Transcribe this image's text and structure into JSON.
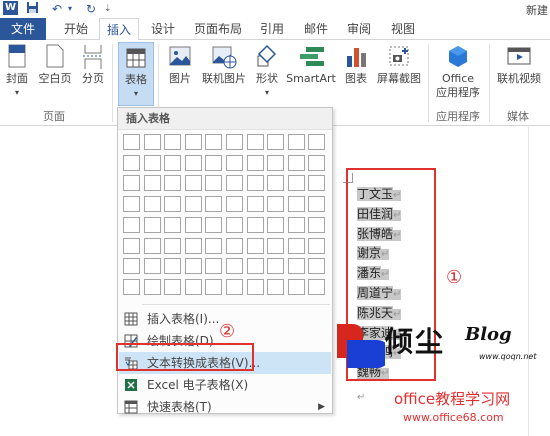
{
  "titlebar": {
    "doc_title": "新建"
  },
  "tabs": [
    {
      "label": "文件"
    },
    {
      "label": "开始"
    },
    {
      "label": "插入"
    },
    {
      "label": "设计"
    },
    {
      "label": "页面布局"
    },
    {
      "label": "引用"
    },
    {
      "label": "邮件"
    },
    {
      "label": "审阅"
    },
    {
      "label": "视图"
    }
  ],
  "ribbon": {
    "pages": {
      "cover": "封面",
      "blank": "空白页",
      "break": "分页",
      "group_label": "页面"
    },
    "table": {
      "label": "表格"
    },
    "illustrations": {
      "picture": "图片",
      "online_picture": "联机图片",
      "shapes": "形状",
      "smartart": "SmartArt",
      "chart": "图表",
      "screenshot": "屏幕截图"
    },
    "apps": {
      "office_apps_line1": "Office",
      "office_apps_line2": "应用程序",
      "group_label": "应用程序"
    },
    "media": {
      "online_video": "联机视频",
      "group_label": "媒体"
    }
  },
  "dropdown": {
    "header": "插入表格",
    "items": [
      {
        "label": "插入表格(I)..."
      },
      {
        "label": "绘制表格(D)"
      },
      {
        "label": "文本转换成表格(V)..."
      },
      {
        "label": "Excel 电子表格(X)"
      },
      {
        "label": "快速表格(T)"
      }
    ]
  },
  "document": {
    "names": [
      "丁文玉",
      "田佳润",
      "张博皓",
      "谢京",
      "潘东",
      "周道宁",
      "陈兆天",
      "李家迪",
      "郑一鸣",
      "魏畅"
    ],
    "pilcrow": "↵"
  },
  "annotations": {
    "circle1": "①",
    "circle2": "②"
  },
  "watermark": {
    "title": "倾尘",
    "blog": "Blog",
    "sub": "www.qoqn.net",
    "line1": "office教程学习网",
    "line2": "www.office68.com"
  },
  "colors": {
    "accent": "#2b579a",
    "annotation": "#e03030",
    "selection": "#c8c8c8",
    "hover": "#cde4f7"
  }
}
